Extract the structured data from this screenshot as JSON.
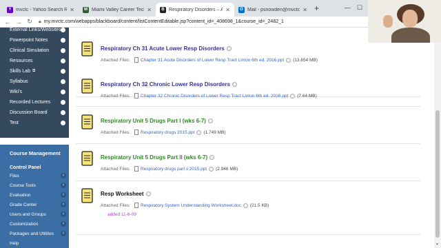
{
  "browser": {
    "tabs": [
      {
        "label": "mvctc - Yahoo Search Results",
        "favicon_color": "#6001d2",
        "active": false
      },
      {
        "label": "Miami Valley Career Technology",
        "favicon_color": "#2f5d2f",
        "active": false
      },
      {
        "label": "Respiratory Disorders – Adult He",
        "favicon_color": "#222222",
        "active": true
      },
      {
        "label": "Mail - psnowden@mvctc.com",
        "favicon_color": "#0072c6",
        "active": false
      }
    ],
    "new_tab": "+",
    "url": "my.mvctc.com/webapps/blackboard/content/listContentEditable.jsp?content_id=_408698_1&course_id=_2482_1"
  },
  "sidebar": {
    "items": [
      {
        "label": "External Links/Websites"
      },
      {
        "label": "Powerpoint Notes"
      },
      {
        "label": "Clinical Simulation"
      },
      {
        "label": "Resources"
      },
      {
        "label": "Skills Lab",
        "external": true
      },
      {
        "label": "Syllabus"
      },
      {
        "label": "Wiki's"
      },
      {
        "label": "Recorded Lectures"
      },
      {
        "label": "Discussion Board"
      },
      {
        "label": "Test"
      }
    ],
    "course_management": {
      "title": "Course Management",
      "control_panel": "Control Panel",
      "items": [
        "Files",
        "Course Tools",
        "Evaluation",
        "Grade Center",
        "Users and Groups",
        "Customization",
        "Packages and Utilities",
        "Help"
      ]
    }
  },
  "content": {
    "items": [
      {
        "title": "Respiratory Ch 31 Acute Lower Resp Disorders",
        "title_color": "navy",
        "files_label": "Attached Files:",
        "file_name": "Chapter 31 Acute Disorders of Lower Resp Tract Linton 6th ed. 2016.ppt",
        "file_size": "(13.654 MB)"
      },
      {
        "title": "Respiratory Ch 32 Chronic Lower Resp Disorders",
        "title_color": "navy",
        "files_label": "Attached Files:",
        "file_name": "Chapter 32 Chronic Disorders of Lower Resp Tract Linton 6th ed. 2016.ppt",
        "file_size": "(7.64 MB)"
      },
      {
        "title": "Respiratory Unit 5 Drugs Part I (wks 6-7)",
        "title_color": "green",
        "files_label": "Attached Files:",
        "file_name": "Respiratory drugs 2015.ppt",
        "file_size": "(1.749 MB)"
      },
      {
        "title": "Respiratory Unit 5 Drugs Part II (wks 6-7)",
        "title_color": "green",
        "files_label": "Attached Files:",
        "file_name": "Respiratory drugs part ii 2015.ppt",
        "file_size": "(2.946 MB)"
      },
      {
        "title": "Resp Worksheet",
        "title_color": "black",
        "files_label": "Attached Files:",
        "file_name": "Respiratory System Understanding Worksheet.doc",
        "file_size": "(21.5 KB)",
        "note": "added 11-6-09"
      }
    ]
  },
  "colors": {
    "menu_bg": "#34495e",
    "course_mgmt_bg": "#3a6ea5",
    "title_navy": "#333399",
    "title_green": "#2e8b22",
    "link_blue": "#3366cc",
    "note_purple": "#aa44cc"
  },
  "icons": {
    "item": "document-icon",
    "file": "file-icon",
    "status": "status-circle-icon"
  }
}
